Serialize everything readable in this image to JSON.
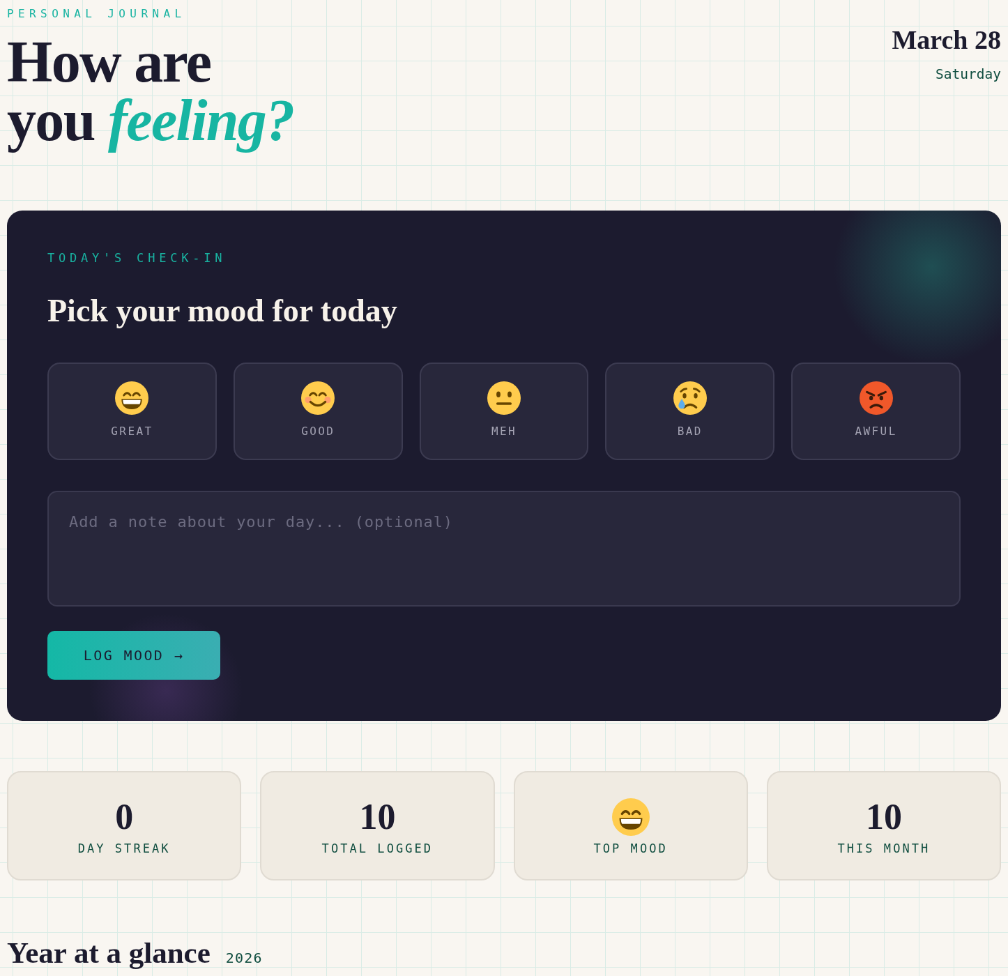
{
  "header": {
    "eyebrow": "PERSONAL JOURNAL",
    "title": "How are you *feeling?*",
    "date": "March 28",
    "weekday": "Saturday"
  },
  "checkin": {
    "eyebrow": "TODAY'S CHECK-IN",
    "title": "Pick your mood for today",
    "moods": [
      {
        "label": "GREAT",
        "kind": "grin",
        "selected": false
      },
      {
        "label": "GOOD",
        "kind": "smile",
        "selected": false
      },
      {
        "label": "MEH",
        "kind": "neutral",
        "selected": false
      },
      {
        "label": "BAD",
        "kind": "tear",
        "selected": false
      },
      {
        "label": "AWFUL",
        "kind": "angry",
        "selected": false
      }
    ],
    "note": {
      "placeholder": "Add a note about your day... (optional)"
    },
    "submit": "LOG MOOD →"
  },
  "stats": [
    {
      "kind": "number",
      "value": "0",
      "label": "DAY STREAK"
    },
    {
      "kind": "number",
      "value": "10",
      "label": "TOTAL LOGGED"
    },
    {
      "kind": "grin",
      "label": "TOP MOOD"
    },
    {
      "kind": "number",
      "value": "10",
      "label": "THIS MONTH"
    }
  ],
  "year": {
    "title": "Year at a glance",
    "year": "2026"
  }
}
